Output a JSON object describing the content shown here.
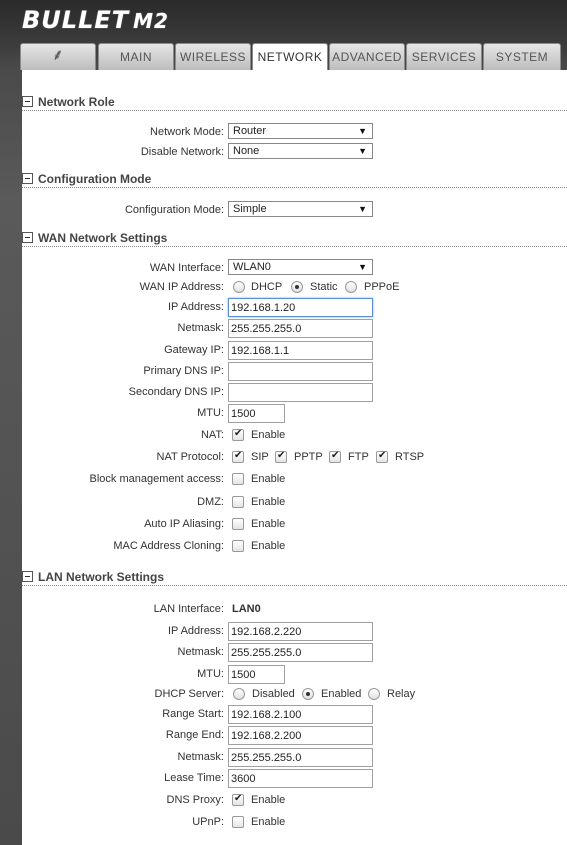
{
  "header": {
    "logo": "BULLET",
    "model": "M2"
  },
  "tabs": [
    {
      "label": "MAIN"
    },
    {
      "label": "WIRELESS"
    },
    {
      "label": "NETWORK"
    },
    {
      "label": "ADVANCED"
    },
    {
      "label": "SERVICES"
    },
    {
      "label": "SYSTEM"
    }
  ],
  "active_tab": "NETWORK",
  "network_role": {
    "title": "Network Role",
    "network_mode_label": "Network Mode:",
    "network_mode_value": "Router",
    "disable_network_label": "Disable Network:",
    "disable_network_value": "None"
  },
  "configuration_mode": {
    "title": "Configuration Mode",
    "label": "Configuration Mode:",
    "value": "Simple"
  },
  "wan": {
    "title": "WAN Network Settings",
    "interface_label": "WAN Interface:",
    "interface_value": "WLAN0",
    "ip_mode_label": "WAN IP Address:",
    "ip_mode_options": [
      "DHCP",
      "Static",
      "PPPoE"
    ],
    "ip_mode_selected": "Static",
    "ip_label": "IP Address:",
    "ip_value": "192.168.1.20",
    "netmask_label": "Netmask:",
    "netmask_value": "255.255.255.0",
    "gateway_label": "Gateway IP:",
    "gateway_value": "192.168.1.1",
    "dns1_label": "Primary DNS IP:",
    "dns1_value": "",
    "dns2_label": "Secondary DNS IP:",
    "dns2_value": "",
    "mtu_label": "MTU:",
    "mtu_value": "1500",
    "nat_label": "NAT:",
    "nat_enable": "Enable",
    "nat_checked": true,
    "nat_protocol_label": "NAT Protocol:",
    "nat_protocols": [
      "SIP",
      "PPTP",
      "FTP",
      "RTSP"
    ],
    "block_mgmt_label": "Block management access:",
    "dmz_label": "DMZ:",
    "auto_ip_label": "Auto IP Aliasing:",
    "mac_clone_label": "MAC Address Cloning:",
    "enable_text": "Enable"
  },
  "lan": {
    "title": "LAN Network Settings",
    "interface_label": "LAN Interface:",
    "interface_value": "LAN0",
    "ip_label": "IP Address:",
    "ip_value": "192.168.2.220",
    "netmask_label": "Netmask:",
    "netmask_value": "255.255.255.0",
    "mtu_label": "MTU:",
    "mtu_value": "1500",
    "dhcp_label": "DHCP Server:",
    "dhcp_options": [
      "Disabled",
      "Enabled",
      "Relay"
    ],
    "dhcp_selected": "Enabled",
    "range_start_label": "Range Start:",
    "range_start_value": "192.168.2.100",
    "range_end_label": "Range End:",
    "range_end_value": "192.168.2.200",
    "dhcp_netmask_label": "Netmask:",
    "dhcp_netmask_value": "255.255.255.0",
    "lease_label": "Lease Time:",
    "lease_value": "3600",
    "dns_proxy_label": "DNS Proxy:",
    "upnp_label": "UPnP:",
    "enable_text": "Enable"
  }
}
